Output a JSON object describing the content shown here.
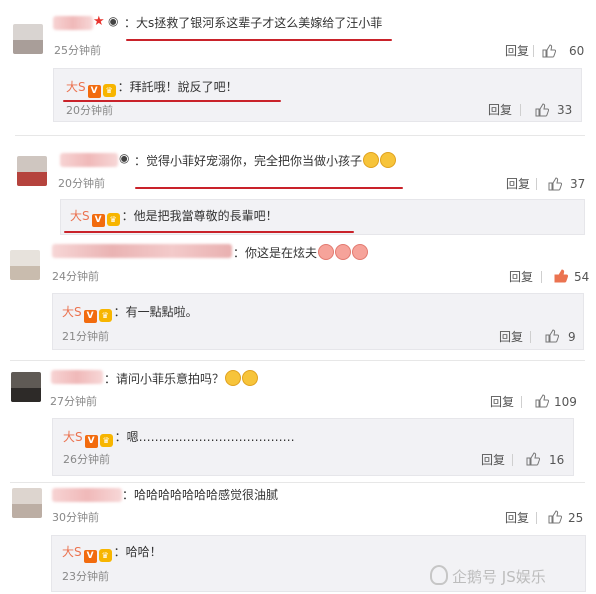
{
  "comments": [
    {
      "text": "：大s拯救了银河系这辈子才这么美嫁给了汪小菲",
      "time": "25分钟前",
      "reply_label": "回复",
      "likes": "60",
      "reply": {
        "name": "大S",
        "text": "：拜託哦！說反了吧！",
        "time": "20分钟前",
        "reply_label": "回复",
        "likes": "33"
      }
    },
    {
      "text": "：觉得小菲好宠溺你，完全把你当做小孩子",
      "time": "20分钟前",
      "reply_label": "回复",
      "likes": "37",
      "reply": {
        "name": "大S",
        "text": "：他是把我當尊敬的長輩吧！",
        "time": "",
        "reply_label": "",
        "likes": ""
      }
    },
    {
      "text": "：你这是在炫夫",
      "time": "24分钟前",
      "reply_label": "回复",
      "likes": "54",
      "reply": {
        "name": "大S",
        "text": "：有一點點啦。",
        "time": "21分钟前",
        "reply_label": "回复",
        "likes": "9"
      }
    },
    {
      "text": "：请问小菲乐意拍吗？",
      "time": "27分钟前",
      "reply_label": "回复",
      "likes": "109",
      "reply": {
        "name": "大S",
        "text": "：嗯…………………………………",
        "time": "26分钟前",
        "reply_label": "回复",
        "likes": "16"
      }
    },
    {
      "text": "：哈哈哈哈哈哈哈感觉很油腻",
      "time": "30分钟前",
      "reply_label": "回复",
      "likes": "25",
      "reply": {
        "name": "大S",
        "text": "：哈哈！",
        "time": "23分钟前",
        "reply_label": "",
        "likes": ""
      }
    }
  ],
  "watermark": "企鹅号 JS娱乐",
  "colors": {
    "highlight_line": "#c9222a",
    "name": "#eb7350",
    "like_active": "#eb7350"
  }
}
